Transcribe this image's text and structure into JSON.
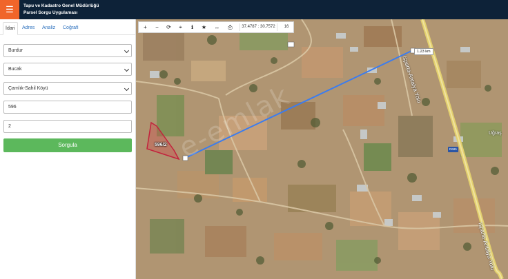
{
  "header": {
    "menu_icon": "hamburger-icon",
    "title_line1": "Tapu ve Kadastro Genel Müdürlüğü",
    "title_line2": "Parsel Sorgu Uygulaması"
  },
  "sidebar": {
    "tabs": [
      {
        "label": "İdari",
        "active": true
      },
      {
        "label": "Adres",
        "active": false
      },
      {
        "label": "Analiz",
        "active": false
      },
      {
        "label": "Coğrafi",
        "active": false
      }
    ],
    "fields": {
      "province": "Burdur",
      "district": "Bucak",
      "neighborhood": "Çamlık-Sahil Köyü",
      "block": "596",
      "parcel": "2"
    },
    "query_button": "Sorgula",
    "query_color": "#5cb85c"
  },
  "map": {
    "coordinates": "37.4787 : 30.7572",
    "zoom": "16",
    "measure_distance": "1.23 km",
    "parcel_label": "596/2",
    "road_label_north": "Isparta-Antalya Yolu",
    "road_label_south": "Isparta-Antalya Yolu",
    "place_label": "Uğraş",
    "road_badge": "D685",
    "watermark": "e-emlak",
    "tools": [
      "zoom-in-icon",
      "zoom-out-icon",
      "refresh-icon",
      "locate-icon",
      "info-icon",
      "star-icon",
      "measure-icon",
      "print-icon"
    ]
  }
}
